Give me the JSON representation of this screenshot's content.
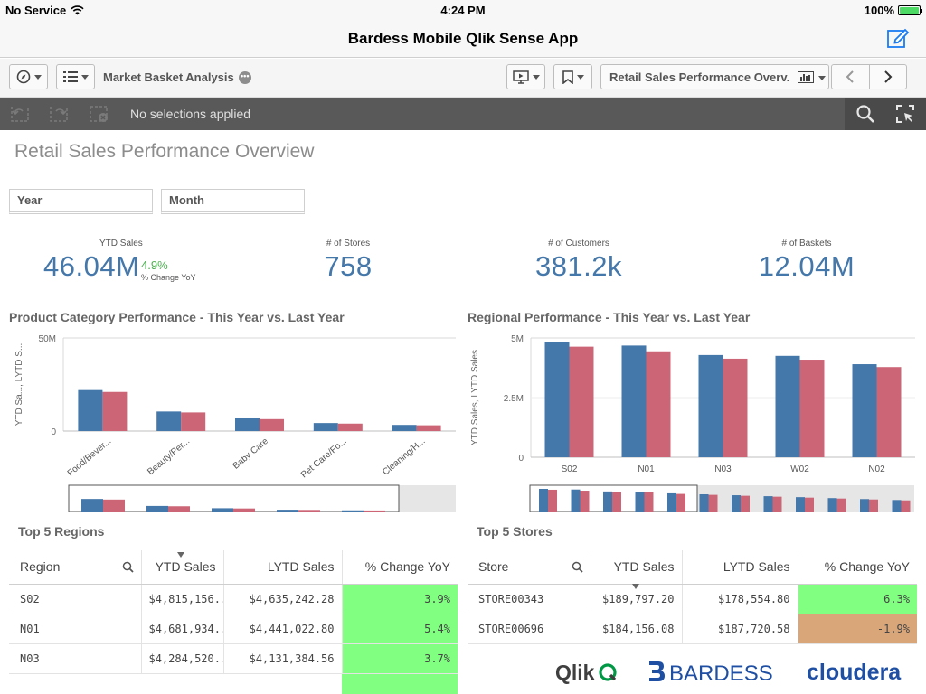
{
  "status_bar": {
    "carrier": "No Service",
    "time": "4:24 PM",
    "battery": "100%"
  },
  "nav_bar": {
    "title": "Bardess Mobile Qlik Sense App"
  },
  "toolbar": {
    "app_name": "Market Basket Analysis",
    "sheet_name": "Retail Sales Performance Overv..."
  },
  "selection_bar": {
    "text": "No selections applied"
  },
  "sheet": {
    "title": "Retail Sales Performance Overview",
    "filters": [
      "Year",
      "Month"
    ]
  },
  "kpis": {
    "ytd_sales": {
      "label": "YTD Sales",
      "value": "46.04M",
      "change": "4.9%",
      "change_label": "% Change YoY"
    },
    "stores": {
      "label": "# of Stores",
      "value": "758"
    },
    "customers": {
      "label": "# of Customers",
      "value": "381.2k"
    },
    "baskets": {
      "label": "# of Baskets",
      "value": "12.04M"
    }
  },
  "colors": {
    "this_year": "#4477aa",
    "last_year": "#cc6677",
    "positive": "#80ff80",
    "negative": "#d9a67a"
  },
  "chart_data": [
    {
      "type": "bar",
      "title": "Product Category Performance - This Year vs. Last Year",
      "ylabel": "YTD Sa..., LYTD S...",
      "ylim": [
        0,
        50000000
      ],
      "y_ticks": [
        "50M",
        "0"
      ],
      "categories": [
        "Food/Bever...",
        "Beauty/Per...",
        "Baby Care",
        "Pet Care/Fo...",
        "Cleaning/H..."
      ],
      "series": [
        {
          "name": "YTD Sales",
          "values": [
            22000000,
            10500000,
            6800000,
            4300000,
            3300000
          ]
        },
        {
          "name": "LYTD Sales",
          "values": [
            21000000,
            10000000,
            6400000,
            4000000,
            3100000
          ]
        }
      ]
    },
    {
      "type": "bar",
      "title": "Regional Performance - This Year vs. Last Year",
      "ylabel": "YTD Sales, LYTD Sales",
      "ylim": [
        0,
        5000000
      ],
      "y_ticks": [
        "5M",
        "2.5M",
        "0"
      ],
      "categories": [
        "S02",
        "N01",
        "N03",
        "W02",
        "N02"
      ],
      "series": [
        {
          "name": "YTD Sales",
          "values": [
            4815156,
            4681934,
            4284520,
            4250000,
            3900000
          ]
        },
        {
          "name": "LYTD Sales",
          "values": [
            4635242,
            4441022,
            4131384,
            4090000,
            3780000
          ]
        }
      ]
    }
  ],
  "top_regions": {
    "title": "Top 5 Regions",
    "columns": [
      "Region",
      "YTD Sales",
      "LYTD Sales",
      "% Change YoY"
    ],
    "rows": [
      [
        "S02",
        "$4,815,156...",
        "$4,635,242.28",
        "3.9%"
      ],
      [
        "N01",
        "$4,681,934...",
        "$4,441,022.80",
        "5.4%"
      ],
      [
        "N03",
        "$4,284,520...",
        "$4,131,384.56",
        "3.7%"
      ]
    ]
  },
  "top_stores": {
    "title": "Top 5 Stores",
    "columns": [
      "Store",
      "YTD Sales",
      "LYTD Sales",
      "% Change YoY"
    ],
    "rows": [
      [
        "STORE00343",
        "$189,797.20",
        "$178,554.80",
        "6.3%"
      ],
      [
        "STORE00696",
        "$184,156.08",
        "$187,720.58",
        "-1.9%"
      ]
    ]
  },
  "logos": {
    "qlik": "Qlik",
    "bardess": "BARDESS",
    "cloudera": "cloudera"
  }
}
